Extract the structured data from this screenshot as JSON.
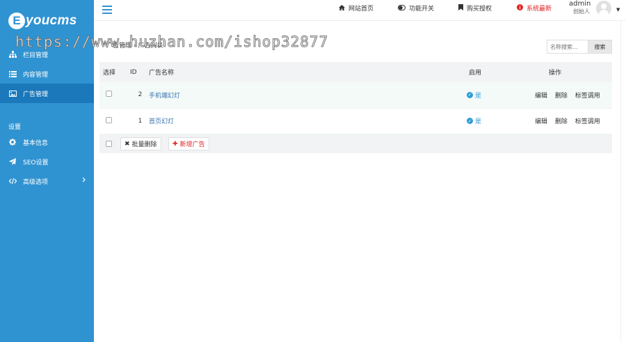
{
  "brand": {
    "logo_letter": "E",
    "logo_text": "youcms"
  },
  "watermark": "https://www.huzhan.com/ishop32877",
  "sidebar": {
    "items": [
      {
        "label": "栏目管理",
        "icon": "sitemap-icon"
      },
      {
        "label": "内容管理",
        "icon": "list-icon"
      },
      {
        "label": "广告管理",
        "icon": "image-icon"
      }
    ],
    "section_label": "设置",
    "settings": [
      {
        "label": "基本信息",
        "icon": "gear-icon"
      },
      {
        "label": "SEO设置",
        "icon": "paper-plane-icon"
      },
      {
        "label": "高级选项",
        "icon": "code-icon"
      }
    ]
  },
  "topbar": {
    "links": [
      {
        "label": "网站首页",
        "icon": "home-icon"
      },
      {
        "label": "功能开关",
        "icon": "toggle-icon"
      },
      {
        "label": "购买授权",
        "icon": "bookmark-icon"
      },
      {
        "label": "系统最新",
        "icon": "info-icon"
      }
    ],
    "user_name": "admin",
    "user_role": "创始人"
  },
  "main": {
    "breadcrumb": "广告管理 › 广告列表",
    "search_placeholder": "名称搜索...",
    "search_button": "搜索",
    "columns": [
      "选择",
      "ID",
      "广告名称",
      "启用",
      "操作"
    ],
    "rows": [
      {
        "id": "2",
        "name": "手机端幻灯",
        "enabled": "是",
        "actions": [
          "编辑",
          "删除",
          "标签调用"
        ]
      },
      {
        "id": "1",
        "name": "首页幻灯",
        "enabled": "是",
        "actions": [
          "编辑",
          "删除",
          "标签调用"
        ]
      }
    ],
    "batch_delete": "批量删除",
    "add_ad": "新增广告"
  },
  "colors": {
    "sidebar_bg": "#3093d1",
    "sidebar_active": "#1a78bb",
    "accent_red": "#e02222",
    "status_blue": "#2c9bdb"
  }
}
